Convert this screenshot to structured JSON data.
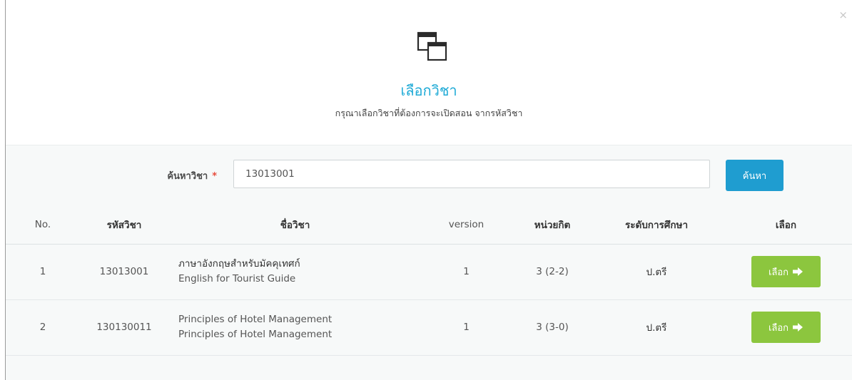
{
  "dialog": {
    "close_glyph": "×",
    "logo_icon": "copy-windows-icon",
    "title": "เลือกวิชา",
    "subtitle": "กรุณาเลือกวิชาที่ต้องการจะเปิดสอน จากรหัสวิชา"
  },
  "search": {
    "label": "ค้นหาวิชา",
    "required_mark": "*",
    "value": "13013001",
    "button_label": "ค้นหา"
  },
  "table": {
    "columns": [
      "No.",
      "รหัสวิชา",
      "ชื่อวิชา",
      "version",
      "หน่วยกิต",
      "ระดับการศึกษา",
      "เลือก"
    ],
    "rows": [
      {
        "no": "1",
        "code": "13013001",
        "name_th": "ภาษาอังกฤษสำหรับมัคคุเทศก์",
        "name_en": "English for Tourist Guide",
        "version": "1",
        "credits": "3 (2-2)",
        "level": "ป.ตรี",
        "select_label": "เลือก",
        "select_icon": "arrow-right-icon"
      },
      {
        "no": "2",
        "code": "130130011",
        "name_th": "Principles of Hotel Management",
        "name_en": "Principles of Hotel Management",
        "version": "1",
        "credits": "3 (3-0)",
        "level": "ป.ตรี",
        "select_label": "เลือก",
        "select_icon": "arrow-right-icon"
      }
    ]
  },
  "colors": {
    "accent_blue": "#1f9dd0",
    "title_blue": "#1eaad6",
    "select_green": "#8cc63e",
    "required_red": "#e74c3c",
    "body_background": "#f7f9f9"
  }
}
